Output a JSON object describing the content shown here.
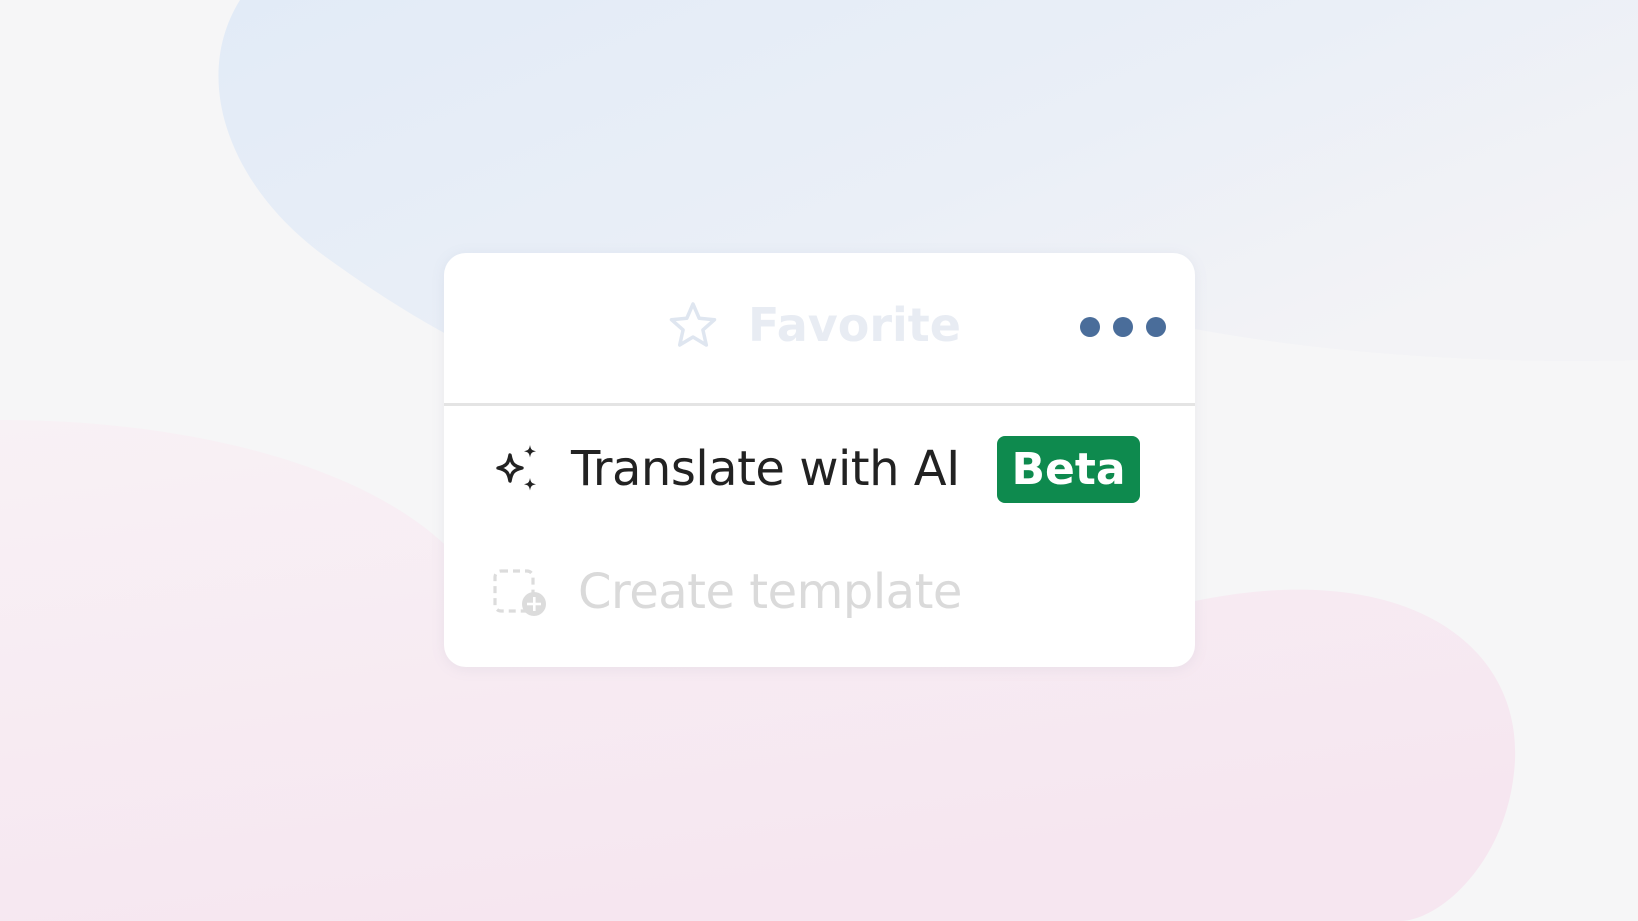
{
  "menu": {
    "favorite": {
      "label": "Favorite",
      "icon": "star-icon",
      "color": "#e8ecf3"
    },
    "more": {
      "icon": "more-dots-icon",
      "color": "#4a6d9a"
    },
    "items": [
      {
        "label": "Translate with AI",
        "icon": "sparkle-icon",
        "badge": "Beta",
        "badge_color": "#0e8a4e"
      },
      {
        "label": "Create template",
        "icon": "create-template-icon",
        "state": "faded"
      }
    ]
  },
  "colors": {
    "background_blue": "#e3ecf7",
    "background_pink": "#f6e8f1"
  }
}
